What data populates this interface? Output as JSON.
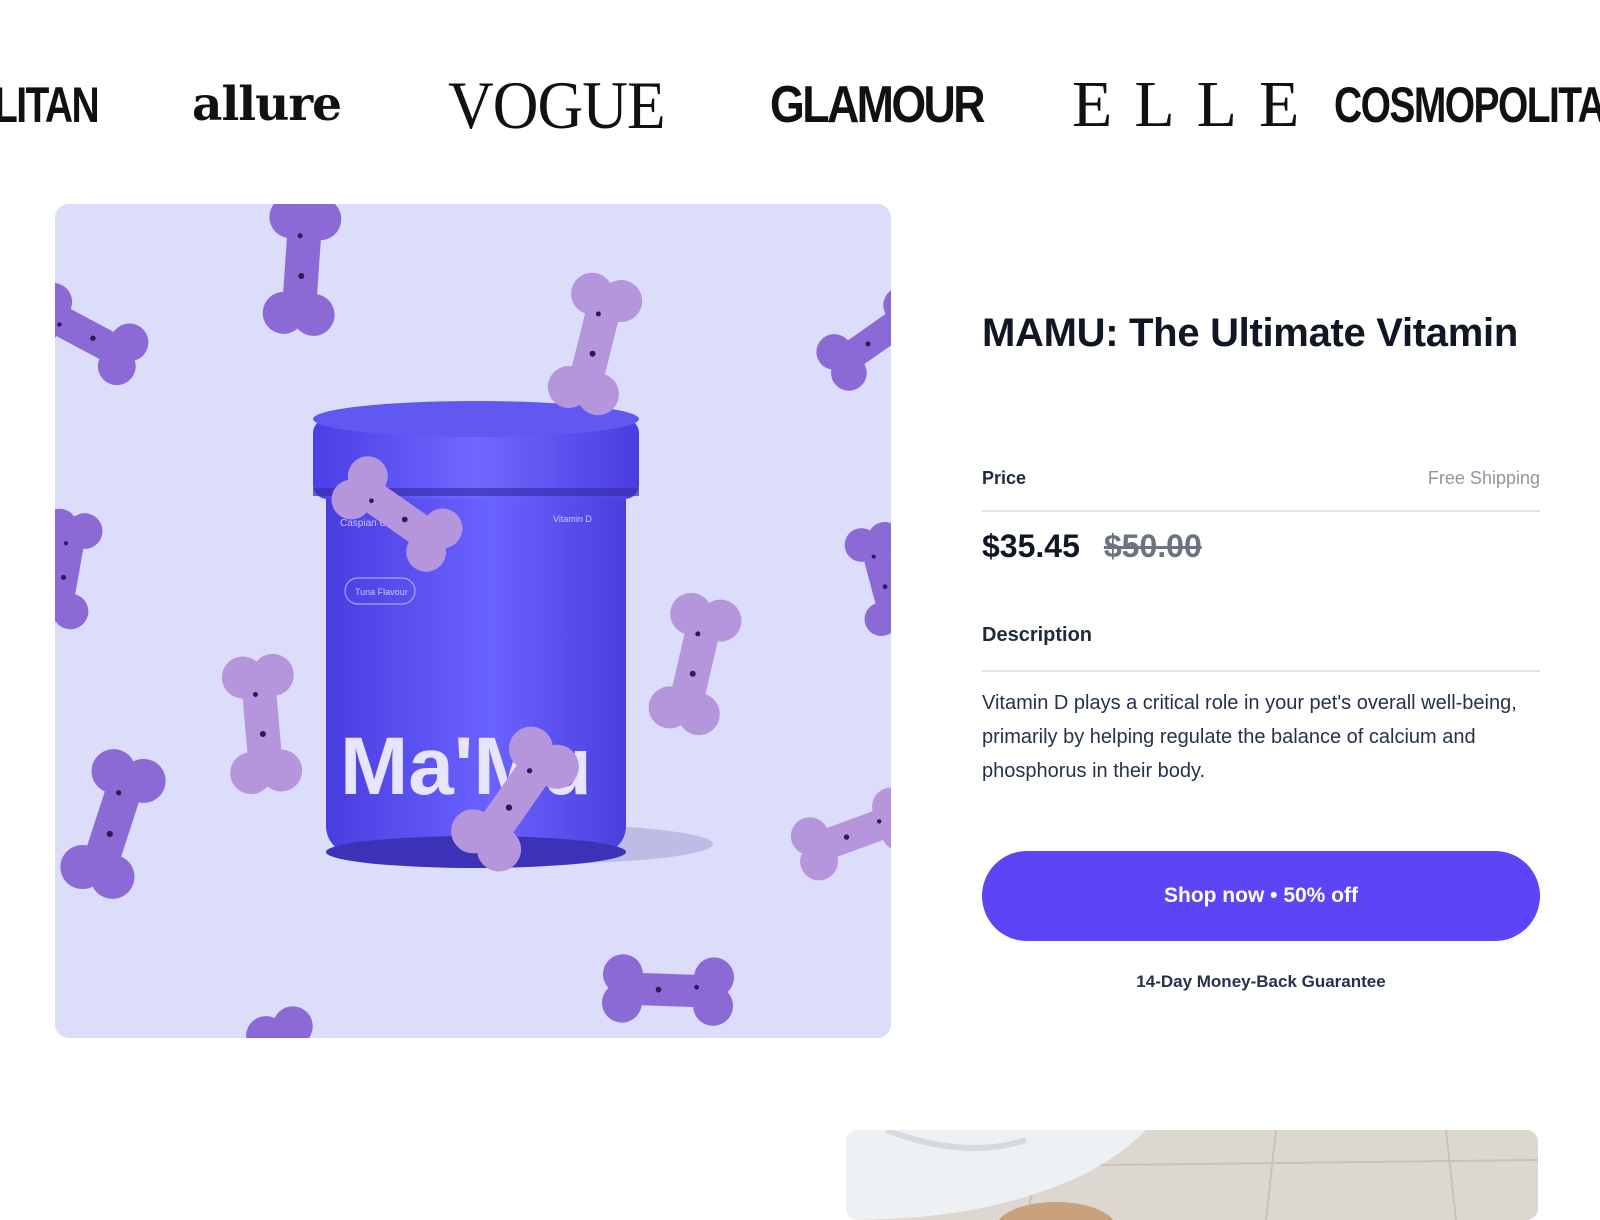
{
  "press": {
    "logos": [
      {
        "name": "COSMOPOLITAN",
        "display": "LITAN"
      },
      {
        "name": "allure",
        "display": "allure"
      },
      {
        "name": "VOGUE",
        "display": "VOGUE"
      },
      {
        "name": "GLAMOUR",
        "display": "GLAMOUR"
      },
      {
        "name": "ELLE",
        "display": "ELLE"
      },
      {
        "name": "COSMOPOLITAN",
        "display": "COSMOPOLITAN"
      }
    ]
  },
  "hero": {
    "brand_text": "Ma'Mu",
    "jar_label": "Vitamin D",
    "jar_pill": "Tuna Flavour",
    "colors": {
      "background": "#dcdcfb",
      "jar": "#5b4df0",
      "bone": "#8f6fd8"
    }
  },
  "product": {
    "title": "MAMU: The Ultimate Vitamin",
    "price_label": "Price",
    "shipping": "Free Shipping",
    "price_current": "$35.45",
    "price_old": "$50.00",
    "description_label": "Description",
    "description": "Vitamin D plays a critical role in your pet's overall well-being, primarily by helping regulate the balance of calcium and phosphorus in their body.",
    "cta_label": "Shop now • 50% off",
    "guarantee": "14-Day Money-Back Guarantee"
  },
  "colors": {
    "accent": "#5b45f6",
    "text": "#101624",
    "muted": "#9097a3"
  }
}
